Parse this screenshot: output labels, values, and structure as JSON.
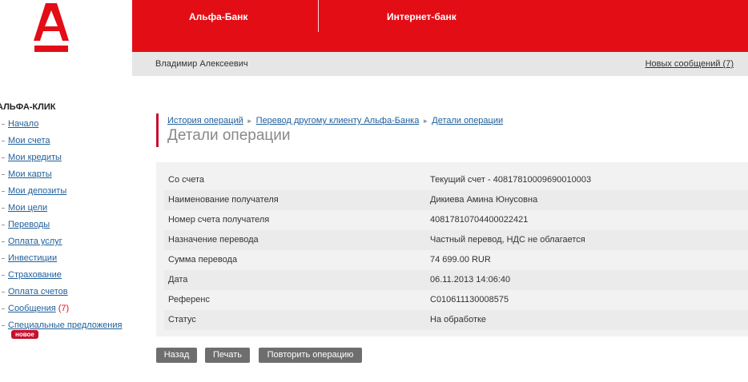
{
  "header": {
    "logo_icon": "alfa-bank-logo-icon",
    "brand_color": "#e30d16",
    "tabs": [
      {
        "label": "Альфа-Банк"
      },
      {
        "label": "Интернет-банк"
      }
    ]
  },
  "userbar": {
    "user_name": "Владимир Алексеевич",
    "messages_link": "Новых сообщений (7)"
  },
  "sidebar": {
    "title": "АЛЬФА-КЛИК",
    "items": [
      {
        "label": "Начало"
      },
      {
        "label": "Мои счета"
      },
      {
        "label": "Мои кредиты"
      },
      {
        "label": "Мои карты"
      },
      {
        "label": "Мои депозиты"
      },
      {
        "label": "Мои цели"
      },
      {
        "label": "Переводы"
      },
      {
        "label": "Оплата услуг"
      },
      {
        "label": "Инвестиции"
      },
      {
        "label": "Страхование"
      },
      {
        "label": "Оплата счетов"
      },
      {
        "label": "Сообщения",
        "count": "(7)"
      },
      {
        "label": "Специальные предложения",
        "badge": "новое"
      }
    ]
  },
  "breadcrumb": {
    "items": [
      "История операций",
      "Перевод другому клиенту Альфа-Банка",
      "Детали операции"
    ]
  },
  "page_title": "Детали операции",
  "details": [
    {
      "label": "Со счета",
      "value": "Текущий счет - 40817810009690010003"
    },
    {
      "label": "Наименование получателя",
      "value": "Дикиева Амина Юнусовна"
    },
    {
      "label": "Номер счета получателя",
      "value": "40817810704400022421"
    },
    {
      "label": "Назначение перевода",
      "value": "Частный перевод, НДС не облагается"
    },
    {
      "label": "Сумма перевода",
      "value": "74 699.00 RUR"
    },
    {
      "label": "Дата",
      "value": "06.11.2013 14:06:40"
    },
    {
      "label": "Референс",
      "value": "C010611130008575"
    },
    {
      "label": "Статус",
      "value": "На обработке"
    }
  ],
  "actions": {
    "back": "Назад",
    "print": "Печать",
    "repeat": "Повторить операцию"
  }
}
